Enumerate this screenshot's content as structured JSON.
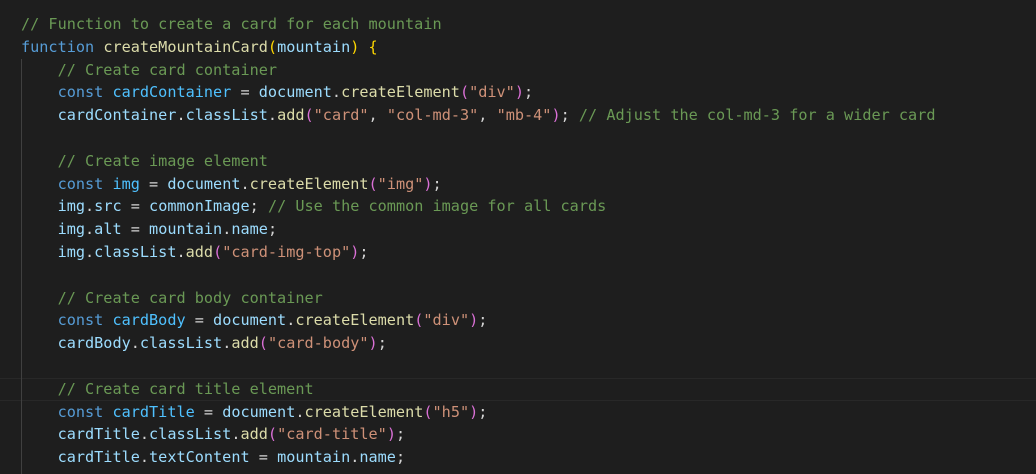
{
  "editor": {
    "lines": [
      {
        "indent": "",
        "tokens": [
          {
            "t": "// Function to create a card for each mountain",
            "c": "cm"
          }
        ]
      },
      {
        "indent": "",
        "tokens": [
          {
            "t": "function",
            "c": "kw"
          },
          {
            "t": " ",
            "c": "op"
          },
          {
            "t": "createMountainCard",
            "c": "fn"
          },
          {
            "t": "(",
            "c": "b1"
          },
          {
            "t": "mountain",
            "c": "vr"
          },
          {
            "t": ")",
            "c": "b1"
          },
          {
            "t": " ",
            "c": "op"
          },
          {
            "t": "{",
            "c": "b1"
          }
        ]
      },
      {
        "indent": "    ",
        "tokens": [
          {
            "t": "// Create card container",
            "c": "cm"
          }
        ]
      },
      {
        "indent": "    ",
        "tokens": [
          {
            "t": "const",
            "c": "kw"
          },
          {
            "t": " ",
            "c": "op"
          },
          {
            "t": "cardContainer",
            "c": "ct"
          },
          {
            "t": " = ",
            "c": "op"
          },
          {
            "t": "document",
            "c": "vr"
          },
          {
            "t": ".",
            "c": "op"
          },
          {
            "t": "createElement",
            "c": "fn"
          },
          {
            "t": "(",
            "c": "b2"
          },
          {
            "t": "\"div\"",
            "c": "st"
          },
          {
            "t": ")",
            "c": "b2"
          },
          {
            "t": ";",
            "c": "op"
          }
        ]
      },
      {
        "indent": "    ",
        "tokens": [
          {
            "t": "cardContainer",
            "c": "vr"
          },
          {
            "t": ".",
            "c": "op"
          },
          {
            "t": "classList",
            "c": "vr"
          },
          {
            "t": ".",
            "c": "op"
          },
          {
            "t": "add",
            "c": "fn"
          },
          {
            "t": "(",
            "c": "b2"
          },
          {
            "t": "\"card\"",
            "c": "st"
          },
          {
            "t": ", ",
            "c": "op"
          },
          {
            "t": "\"col-md-3\"",
            "c": "st"
          },
          {
            "t": ", ",
            "c": "op"
          },
          {
            "t": "\"mb-4\"",
            "c": "st"
          },
          {
            "t": ")",
            "c": "b2"
          },
          {
            "t": "; ",
            "c": "op"
          },
          {
            "t": "// Adjust the col-md-3 for a wider card",
            "c": "cm"
          }
        ]
      },
      {
        "indent": "",
        "tokens": []
      },
      {
        "indent": "    ",
        "tokens": [
          {
            "t": "// Create image element",
            "c": "cm"
          }
        ]
      },
      {
        "indent": "    ",
        "tokens": [
          {
            "t": "const",
            "c": "kw"
          },
          {
            "t": " ",
            "c": "op"
          },
          {
            "t": "img",
            "c": "ct"
          },
          {
            "t": " = ",
            "c": "op"
          },
          {
            "t": "document",
            "c": "vr"
          },
          {
            "t": ".",
            "c": "op"
          },
          {
            "t": "createElement",
            "c": "fn"
          },
          {
            "t": "(",
            "c": "b2"
          },
          {
            "t": "\"img\"",
            "c": "st"
          },
          {
            "t": ")",
            "c": "b2"
          },
          {
            "t": ";",
            "c": "op"
          }
        ]
      },
      {
        "indent": "    ",
        "tokens": [
          {
            "t": "img",
            "c": "vr"
          },
          {
            "t": ".",
            "c": "op"
          },
          {
            "t": "src",
            "c": "vr"
          },
          {
            "t": " = ",
            "c": "op"
          },
          {
            "t": "commonImage",
            "c": "vr"
          },
          {
            "t": "; ",
            "c": "op"
          },
          {
            "t": "// Use the common image for all cards",
            "c": "cm"
          }
        ]
      },
      {
        "indent": "    ",
        "tokens": [
          {
            "t": "img",
            "c": "vr"
          },
          {
            "t": ".",
            "c": "op"
          },
          {
            "t": "alt",
            "c": "vr"
          },
          {
            "t": " = ",
            "c": "op"
          },
          {
            "t": "mountain",
            "c": "vr"
          },
          {
            "t": ".",
            "c": "op"
          },
          {
            "t": "name",
            "c": "vr"
          },
          {
            "t": ";",
            "c": "op"
          }
        ]
      },
      {
        "indent": "    ",
        "tokens": [
          {
            "t": "img",
            "c": "vr"
          },
          {
            "t": ".",
            "c": "op"
          },
          {
            "t": "classList",
            "c": "vr"
          },
          {
            "t": ".",
            "c": "op"
          },
          {
            "t": "add",
            "c": "fn"
          },
          {
            "t": "(",
            "c": "b2"
          },
          {
            "t": "\"card-img-top\"",
            "c": "st"
          },
          {
            "t": ")",
            "c": "b2"
          },
          {
            "t": ";",
            "c": "op"
          }
        ]
      },
      {
        "indent": "",
        "tokens": []
      },
      {
        "indent": "    ",
        "tokens": [
          {
            "t": "// Create card body container",
            "c": "cm"
          }
        ]
      },
      {
        "indent": "    ",
        "tokens": [
          {
            "t": "const",
            "c": "kw"
          },
          {
            "t": " ",
            "c": "op"
          },
          {
            "t": "cardBody",
            "c": "ct"
          },
          {
            "t": " = ",
            "c": "op"
          },
          {
            "t": "document",
            "c": "vr"
          },
          {
            "t": ".",
            "c": "op"
          },
          {
            "t": "createElement",
            "c": "fn"
          },
          {
            "t": "(",
            "c": "b2"
          },
          {
            "t": "\"div\"",
            "c": "st"
          },
          {
            "t": ")",
            "c": "b2"
          },
          {
            "t": ";",
            "c": "op"
          }
        ]
      },
      {
        "indent": "    ",
        "tokens": [
          {
            "t": "cardBody",
            "c": "vr"
          },
          {
            "t": ".",
            "c": "op"
          },
          {
            "t": "classList",
            "c": "vr"
          },
          {
            "t": ".",
            "c": "op"
          },
          {
            "t": "add",
            "c": "fn"
          },
          {
            "t": "(",
            "c": "b2"
          },
          {
            "t": "\"card-body\"",
            "c": "st"
          },
          {
            "t": ")",
            "c": "b2"
          },
          {
            "t": ";",
            "c": "op"
          }
        ]
      },
      {
        "indent": "",
        "tokens": []
      },
      {
        "indent": "    ",
        "tokens": [
          {
            "t": "// Create card title element",
            "c": "cm"
          }
        ]
      },
      {
        "indent": "    ",
        "tokens": [
          {
            "t": "const",
            "c": "kw"
          },
          {
            "t": " ",
            "c": "op"
          },
          {
            "t": "cardTitle",
            "c": "ct"
          },
          {
            "t": " = ",
            "c": "op"
          },
          {
            "t": "document",
            "c": "vr"
          },
          {
            "t": ".",
            "c": "op"
          },
          {
            "t": "createElement",
            "c": "fn"
          },
          {
            "t": "(",
            "c": "b2"
          },
          {
            "t": "\"h5\"",
            "c": "st"
          },
          {
            "t": ")",
            "c": "b2"
          },
          {
            "t": ";",
            "c": "op"
          }
        ]
      },
      {
        "indent": "    ",
        "tokens": [
          {
            "t": "cardTitle",
            "c": "vr"
          },
          {
            "t": ".",
            "c": "op"
          },
          {
            "t": "classList",
            "c": "vr"
          },
          {
            "t": ".",
            "c": "op"
          },
          {
            "t": "add",
            "c": "fn"
          },
          {
            "t": "(",
            "c": "b2"
          },
          {
            "t": "\"card-title\"",
            "c": "st"
          },
          {
            "t": ")",
            "c": "b2"
          },
          {
            "t": ";",
            "c": "op"
          }
        ]
      },
      {
        "indent": "    ",
        "tokens": [
          {
            "t": "cardTitle",
            "c": "vr"
          },
          {
            "t": ".",
            "c": "op"
          },
          {
            "t": "textContent",
            "c": "vr"
          },
          {
            "t": " = ",
            "c": "op"
          },
          {
            "t": "mountain",
            "c": "vr"
          },
          {
            "t": ".",
            "c": "op"
          },
          {
            "t": "name",
            "c": "vr"
          },
          {
            "t": ";",
            "c": "op"
          }
        ]
      }
    ]
  }
}
